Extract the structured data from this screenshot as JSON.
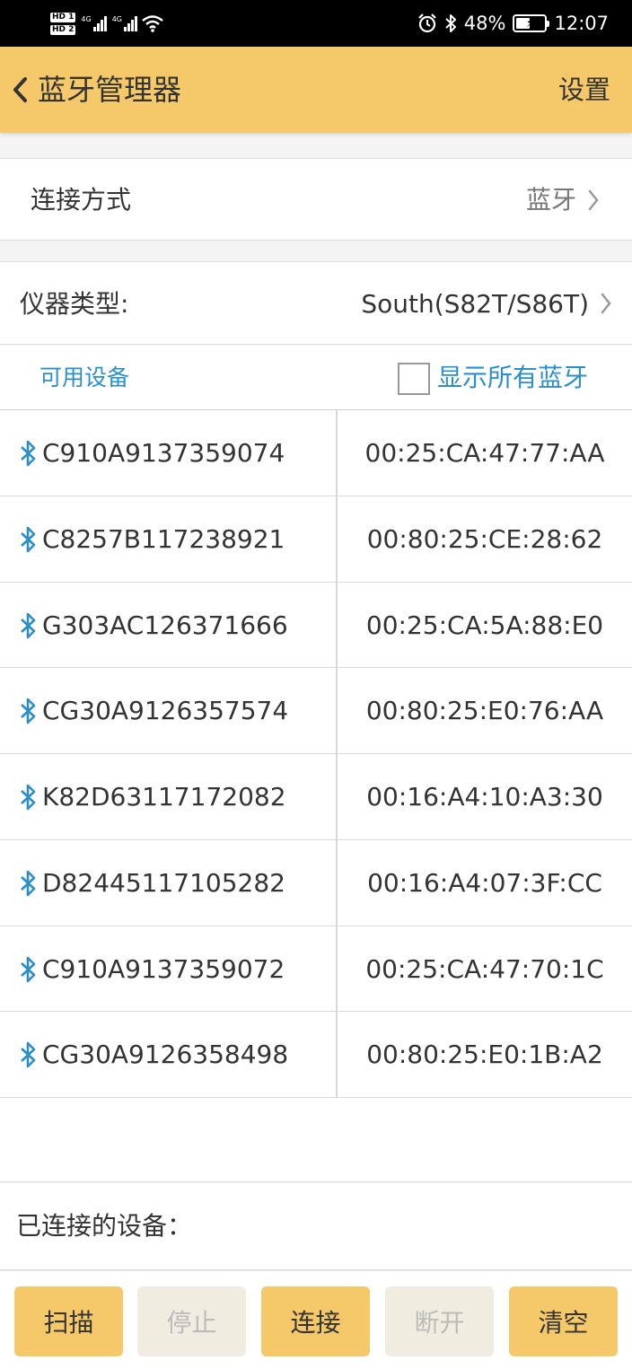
{
  "status_bar": {
    "sim1": "HD 1",
    "sim2": "HD 2",
    "net1": "4G",
    "net2": "4G",
    "battery_percent": "48%",
    "battery_level": 0.48,
    "time": "12:07",
    "icons": [
      "alarm-icon",
      "bluetooth-icon",
      "wifi-icon",
      "battery-icon"
    ]
  },
  "app_bar": {
    "title": "蓝牙管理器",
    "settings_label": "设置",
    "background": "#f5c96a"
  },
  "connection": {
    "label": "连接方式",
    "value": "蓝牙"
  },
  "instrument": {
    "label": "仪器类型:",
    "value": "South(S82T/S86T)"
  },
  "available": {
    "label": "可用设备",
    "show_all_label": "显示所有蓝牙",
    "show_all_checked": false,
    "accent": "#2d8fc9"
  },
  "devices": [
    {
      "name": "C910A9137359074",
      "mac": "00:25:CA:47:77:AA"
    },
    {
      "name": "C8257B117238921",
      "mac": "00:80:25:CE:28:62"
    },
    {
      "name": "G303AC126371666",
      "mac": "00:25:CA:5A:88:E0"
    },
    {
      "name": "CG30A9126357574",
      "mac": "00:80:25:E0:76:AA"
    },
    {
      "name": "K82D63117172082",
      "mac": "00:16:A4:10:A3:30"
    },
    {
      "name": "D82445117105282",
      "mac": "00:16:A4:07:3F:CC"
    },
    {
      "name": "C910A9137359072",
      "mac": "00:25:CA:47:70:1C"
    },
    {
      "name": "CG30A9126358498",
      "mac": "00:80:25:E0:1B:A2"
    }
  ],
  "connected": {
    "label": "已连接的设备："
  },
  "buttons": {
    "scan": "扫描",
    "stop": "停止",
    "connect": "连接",
    "disconnect": "断开",
    "clear": "清空"
  }
}
